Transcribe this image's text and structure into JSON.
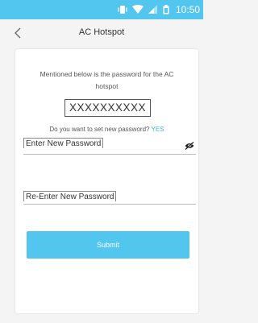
{
  "status_bar": {
    "time": "10:50",
    "icons": [
      "vibrate-icon",
      "wifi-icon",
      "signal-icon",
      "battery-icon"
    ]
  },
  "header": {
    "back_icon": "chevron-left-icon",
    "title": "AC Hotspot"
  },
  "card": {
    "intro_text": "Mentioned below is the password for the AC hotspot",
    "password_value": "XXXXXXXXXX",
    "question_text": "Do you want to set new password?",
    "yes_link": "YES",
    "new_password_placeholder": "Enter New Password",
    "reenter_password_placeholder": "Re-Enter New Password",
    "visibility_icon": "eye-off-icon",
    "submit_label": "Submit"
  },
  "colors": {
    "accent": "#52c6ee",
    "link": "#3fb6e0",
    "background": "#f4f4f4"
  }
}
